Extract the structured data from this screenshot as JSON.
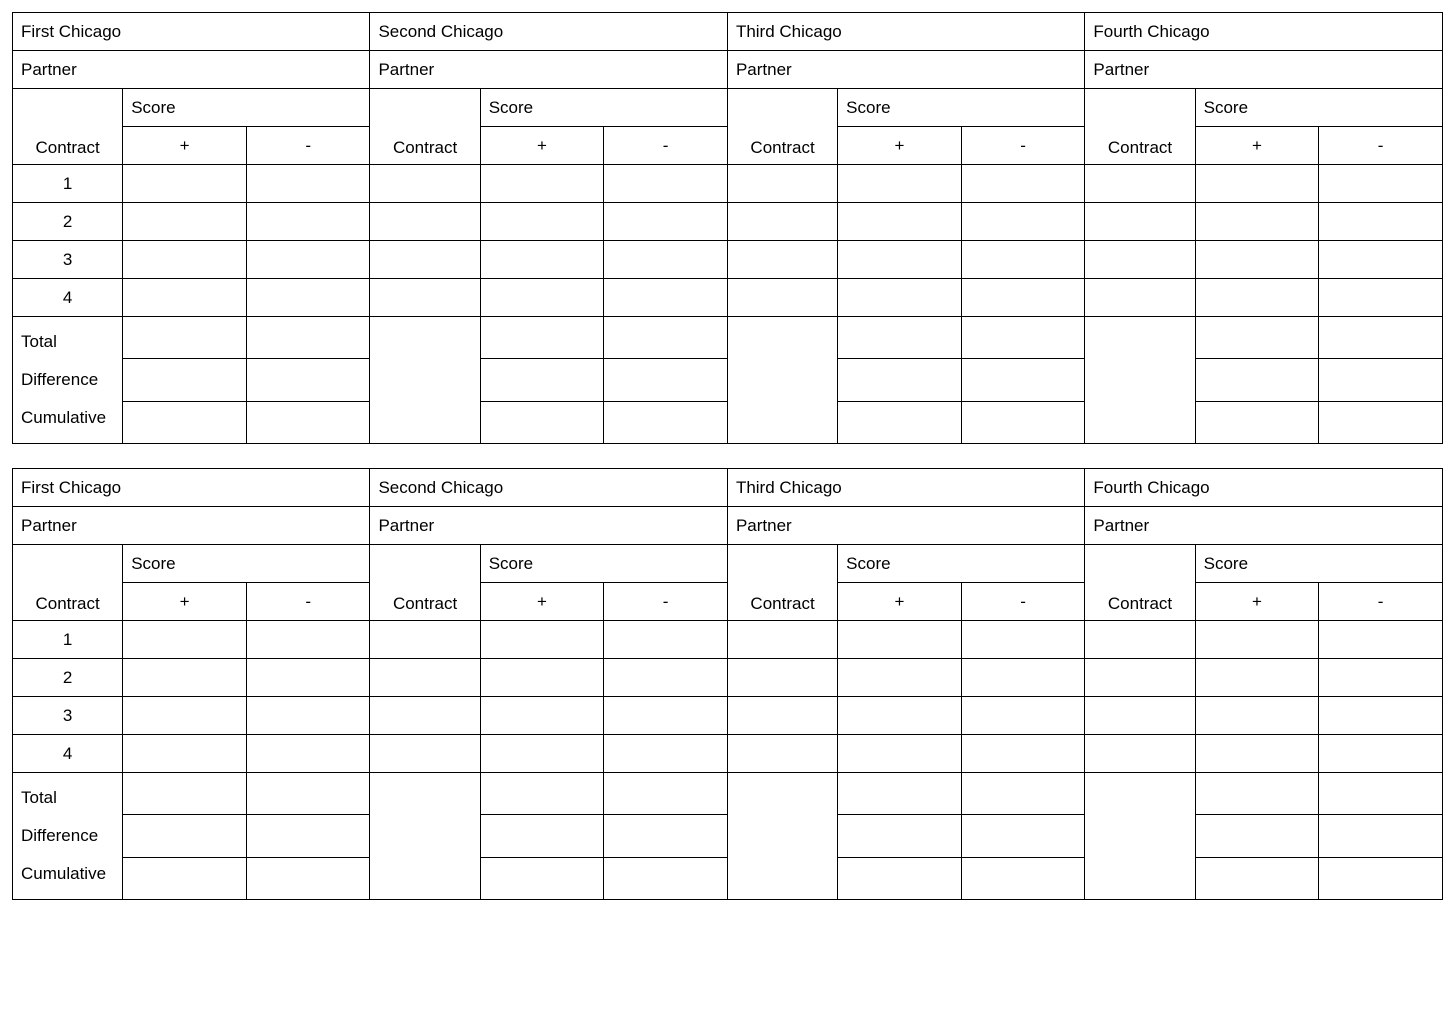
{
  "labels": {
    "partner": "Partner",
    "score": "Score",
    "contract": "Contract",
    "plus": "+",
    "minus": "-",
    "total": "Total",
    "difference": "Difference",
    "cumulative": "Cumulative"
  },
  "panels": [
    "First Chicago",
    "Second Chicago",
    "Third Chicago",
    "Fourth Chicago"
  ],
  "rows": [
    "1",
    "2",
    "3",
    "4"
  ],
  "blocks": 2
}
